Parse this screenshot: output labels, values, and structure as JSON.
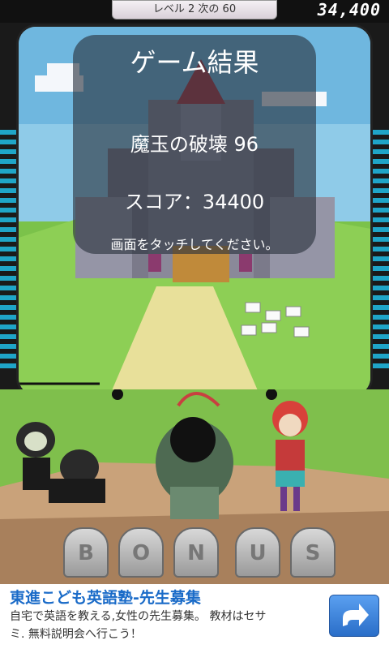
{
  "hud": {
    "level_label": "レベル 2 次の 60",
    "score": "34,400"
  },
  "result": {
    "title": "ゲーム結果",
    "orbs_destroyed": "魔玉の破壊 96",
    "score_line": "スコア：34400",
    "prompt": "画面をタッチしてください。"
  },
  "bonus_letters": [
    "B",
    "O",
    "N",
    "U",
    "S"
  ],
  "ad": {
    "title": "東進こども英語塾-先生募集",
    "body_line1": "自宅で英語を教える,女性の先生募集。 教材はセサ",
    "body_line2": "ミ. 無料説明会へ行こう！",
    "icon": "share-arrow-icon"
  },
  "colors": {
    "accent_blue": "#1a6bc8",
    "side_bars": "#1fa5c8"
  }
}
